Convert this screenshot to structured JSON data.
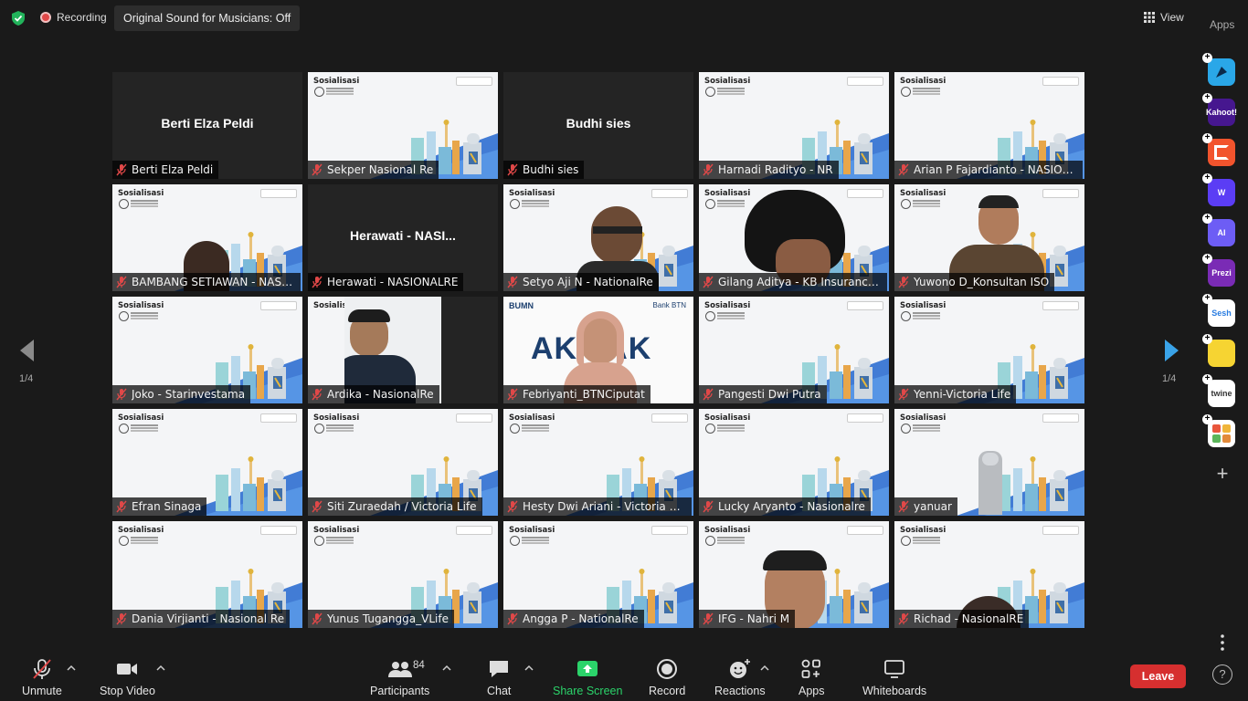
{
  "topbar": {
    "recording_label": "Recording",
    "sound_button": "Original Sound for Musicians: Off",
    "view_label": "View",
    "apps_label": "Apps"
  },
  "slide": {
    "title": "Sosialisasi"
  },
  "banner": {
    "text": "AK   AK",
    "left_logo": "BUMN",
    "right_logo": "Bank BTN"
  },
  "tiles": [
    {
      "name": "Berti Elza Peldi",
      "center_name": "Berti Elza Peldi",
      "kind": "name"
    },
    {
      "name": "Sekper Nasional Re",
      "kind": "slide"
    },
    {
      "name": "Budhi sies",
      "center_name": "Budhi sies",
      "kind": "name"
    },
    {
      "name": "Harnadi Radityo - NR",
      "kind": "slide"
    },
    {
      "name": "Arian P Fajardianto - NASION...",
      "kind": "slide"
    },
    {
      "name": "BAMBANG SETIAWAN - NASION...",
      "kind": "slide-person"
    },
    {
      "name": "Herawati - NASIONALRE",
      "center_name": "Herawati  -  NASI...",
      "kind": "name"
    },
    {
      "name": "Setyo Aji N - NationalRe",
      "kind": "slide-person"
    },
    {
      "name": "Gilang Aditya - KB Insurance I...",
      "kind": "slide-person"
    },
    {
      "name": "Yuwono D_Konsultan ISO",
      "kind": "slide-person"
    },
    {
      "name": "Joko - Starinvestama",
      "kind": "slide"
    },
    {
      "name": "Ardika - NasionalRe",
      "kind": "webcam"
    },
    {
      "name": "Febriyanti_BTNCiputat",
      "kind": "banner"
    },
    {
      "name": "Pangesti Dwi Putra",
      "kind": "slide"
    },
    {
      "name": "Yenni-Victoria Life",
      "kind": "slide"
    },
    {
      "name": "Efran Sinaga",
      "kind": "slide"
    },
    {
      "name": "Siti Zuraedah / Victoria Life",
      "kind": "slide"
    },
    {
      "name": "Hesty Dwi Ariani - Victoria Life",
      "kind": "slide"
    },
    {
      "name": "Lucky Aryanto - Nasionalre",
      "kind": "slide"
    },
    {
      "name": "yanuar",
      "kind": "slide"
    },
    {
      "name": "Dania Virjianti - Nasional Re",
      "kind": "slide"
    },
    {
      "name": "Yunus Tugangga_VLife",
      "kind": "slide"
    },
    {
      "name": "Angga P - NationalRe",
      "kind": "slide"
    },
    {
      "name": "IFG - Nahri M",
      "kind": "slide-person"
    },
    {
      "name": "Richad - NasionalRE",
      "kind": "slide-person"
    }
  ],
  "pagination": {
    "left": "1/4",
    "right": "1/4"
  },
  "apps": [
    {
      "label": "",
      "color": "#2aa7e8"
    },
    {
      "label": "Kahoot!",
      "color": "#46178f"
    },
    {
      "label": "",
      "color": "#f2542d"
    },
    {
      "label": "W",
      "color": "#5b3df5"
    },
    {
      "label": "AI",
      "color": "#6d5df5"
    },
    {
      "label": "Prezi",
      "color": "#7a2bb5"
    },
    {
      "label": "Sesh",
      "color": "#ffffff"
    },
    {
      "label": "",
      "color": "#f6d432"
    },
    {
      "label": "twine",
      "color": "#ffffff"
    },
    {
      "label": "",
      "color": "#ffffff"
    }
  ],
  "toolbar": {
    "unmute": "Unmute",
    "stop_video": "Stop Video",
    "participants": "Participants",
    "participants_count": "84",
    "chat": "Chat",
    "share_screen": "Share Screen",
    "record": "Record",
    "reactions": "Reactions",
    "apps": "Apps",
    "whiteboards": "Whiteboards",
    "leave": "Leave",
    "help": "?"
  },
  "colors": {
    "accent_green": "#2bd36a",
    "leave_red": "#d62f2f",
    "active_outline": "#b9e34a",
    "arrow_blue": "#3aa3e8"
  }
}
